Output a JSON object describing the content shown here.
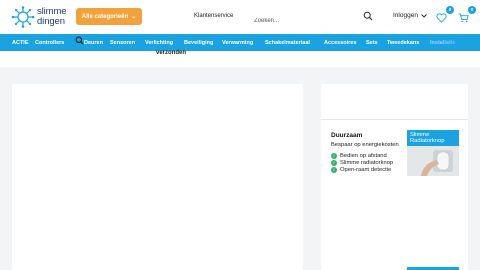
{
  "brand": {
    "line1": "slimme",
    "line2": "dingen",
    "color": "#1f3b64",
    "accent": "#1aa3e0"
  },
  "header": {
    "categories_button": "Alle categorieën",
    "customer_service": "Klantenservice",
    "search_placeholder": "Zoeken...",
    "login": "Inloggen",
    "wishlist_count": "0",
    "cart_count": "0"
  },
  "category_bar": {
    "items": [
      {
        "label": "ACTIE"
      },
      {
        "label": "Controllers"
      },
      {
        "label": "Deuren"
      },
      {
        "label": "Sensoren"
      },
      {
        "label": "Verlichting"
      },
      {
        "label": "Beveiliging"
      },
      {
        "label": "Verwarming"
      },
      {
        "label": "Schakelmateriaal"
      },
      {
        "label": "Accessoires"
      },
      {
        "label": "Sets"
      },
      {
        "label": "Tweedekans"
      },
      {
        "label": "Installatie"
      }
    ]
  },
  "notice": {
    "shipping": "verzonden"
  },
  "promo": {
    "title": "Duurzaam",
    "subtitle": "Bespaar op energiekosten",
    "features": [
      "Bedien op afstand",
      "Slimme radiatorknop",
      "Open-raam detectie"
    ],
    "product_label": "Slimme Radiatorknop"
  },
  "colors": {
    "orange": "#f2a23a",
    "blue": "#1aa3e0",
    "green": "#35b36a"
  }
}
